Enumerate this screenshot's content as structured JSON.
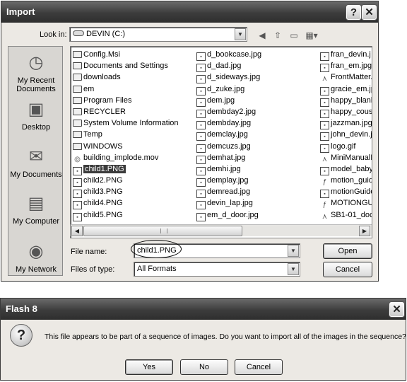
{
  "import_dialog": {
    "title": "Import",
    "help_button": "?",
    "close_button": "✕",
    "look_in_label": "Look in:",
    "look_in_value": "DEVIN (C:)",
    "places": [
      {
        "label": "My Recent Documents",
        "icon": "recent-documents-icon"
      },
      {
        "label": "Desktop",
        "icon": "desktop-icon"
      },
      {
        "label": "My Documents",
        "icon": "my-documents-icon"
      },
      {
        "label": "My Computer",
        "icon": "my-computer-icon"
      },
      {
        "label": "My Network",
        "icon": "my-network-icon"
      }
    ],
    "files": {
      "column1": [
        {
          "name": "Config.Msi",
          "type": "folder"
        },
        {
          "name": "Documents and Settings",
          "type": "folder"
        },
        {
          "name": "downloads",
          "type": "folder"
        },
        {
          "name": "em",
          "type": "folder"
        },
        {
          "name": "Program Files",
          "type": "folder"
        },
        {
          "name": "RECYCLER",
          "type": "folder"
        },
        {
          "name": "System Volume Information",
          "type": "folder"
        },
        {
          "name": "Temp",
          "type": "folder"
        },
        {
          "name": "WINDOWS",
          "type": "folder"
        },
        {
          "name": "building_implode.mov",
          "type": "movie"
        },
        {
          "name": "child1.PNG",
          "type": "image",
          "selected": true
        },
        {
          "name": "child2.PNG",
          "type": "image"
        },
        {
          "name": "child3.PNG",
          "type": "image"
        },
        {
          "name": "child4.PNG",
          "type": "image"
        },
        {
          "name": "child5.PNG",
          "type": "image"
        }
      ],
      "column2": [
        {
          "name": "d_bookcase.jpg",
          "type": "image"
        },
        {
          "name": "d_dad.jpg",
          "type": "image"
        },
        {
          "name": "d_sideways.jpg",
          "type": "image"
        },
        {
          "name": "d_zuke.jpg",
          "type": "image"
        },
        {
          "name": "dem.jpg",
          "type": "image"
        },
        {
          "name": "dembday2.jpg",
          "type": "image"
        },
        {
          "name": "dembday.jpg",
          "type": "image"
        },
        {
          "name": "demclay.jpg",
          "type": "image"
        },
        {
          "name": "demcuzs.jpg",
          "type": "image"
        },
        {
          "name": "demhat.jpg",
          "type": "image"
        },
        {
          "name": "demhi.jpg",
          "type": "image"
        },
        {
          "name": "demplay.jpg",
          "type": "image"
        },
        {
          "name": "demread.jpg",
          "type": "image"
        },
        {
          "name": "devin_lap.jpg",
          "type": "image"
        },
        {
          "name": "em_d_door.jpg",
          "type": "image"
        }
      ],
      "column3": [
        {
          "name": "fran_devin.j",
          "type": "image"
        },
        {
          "name": "fran_em.jpg",
          "type": "image"
        },
        {
          "name": "FrontMatter.",
          "type": "pdf"
        },
        {
          "name": "gracie_em.jp",
          "type": "image"
        },
        {
          "name": "happy_blank",
          "type": "image"
        },
        {
          "name": "happy_cousi",
          "type": "image"
        },
        {
          "name": "jazzman.jpg",
          "type": "image"
        },
        {
          "name": "john_devin.j",
          "type": "image"
        },
        {
          "name": "logo.gif",
          "type": "image"
        },
        {
          "name": "MiniManualIr",
          "type": "pdf"
        },
        {
          "name": "model_baby",
          "type": "image"
        },
        {
          "name": "motion_guide",
          "type": "flash"
        },
        {
          "name": "motionGuide",
          "type": "image"
        },
        {
          "name": "MOTIONGUII",
          "type": "flash"
        },
        {
          "name": "SB1-01_dock",
          "type": "pdf"
        }
      ]
    },
    "file_name_label": "File name:",
    "file_name_value": "child1.PNG",
    "files_of_type_label": "Files of type:",
    "files_of_type_value": "All Formats",
    "open_button": "Open",
    "cancel_button": "Cancel"
  },
  "flash_dialog": {
    "title": "Flash 8",
    "close_button": "✕",
    "message": "This file appears to be part of a sequence of images. Do you want to import all of the images in the sequence?",
    "yes_button": "Yes",
    "no_button": "No",
    "cancel_button": "Cancel"
  }
}
